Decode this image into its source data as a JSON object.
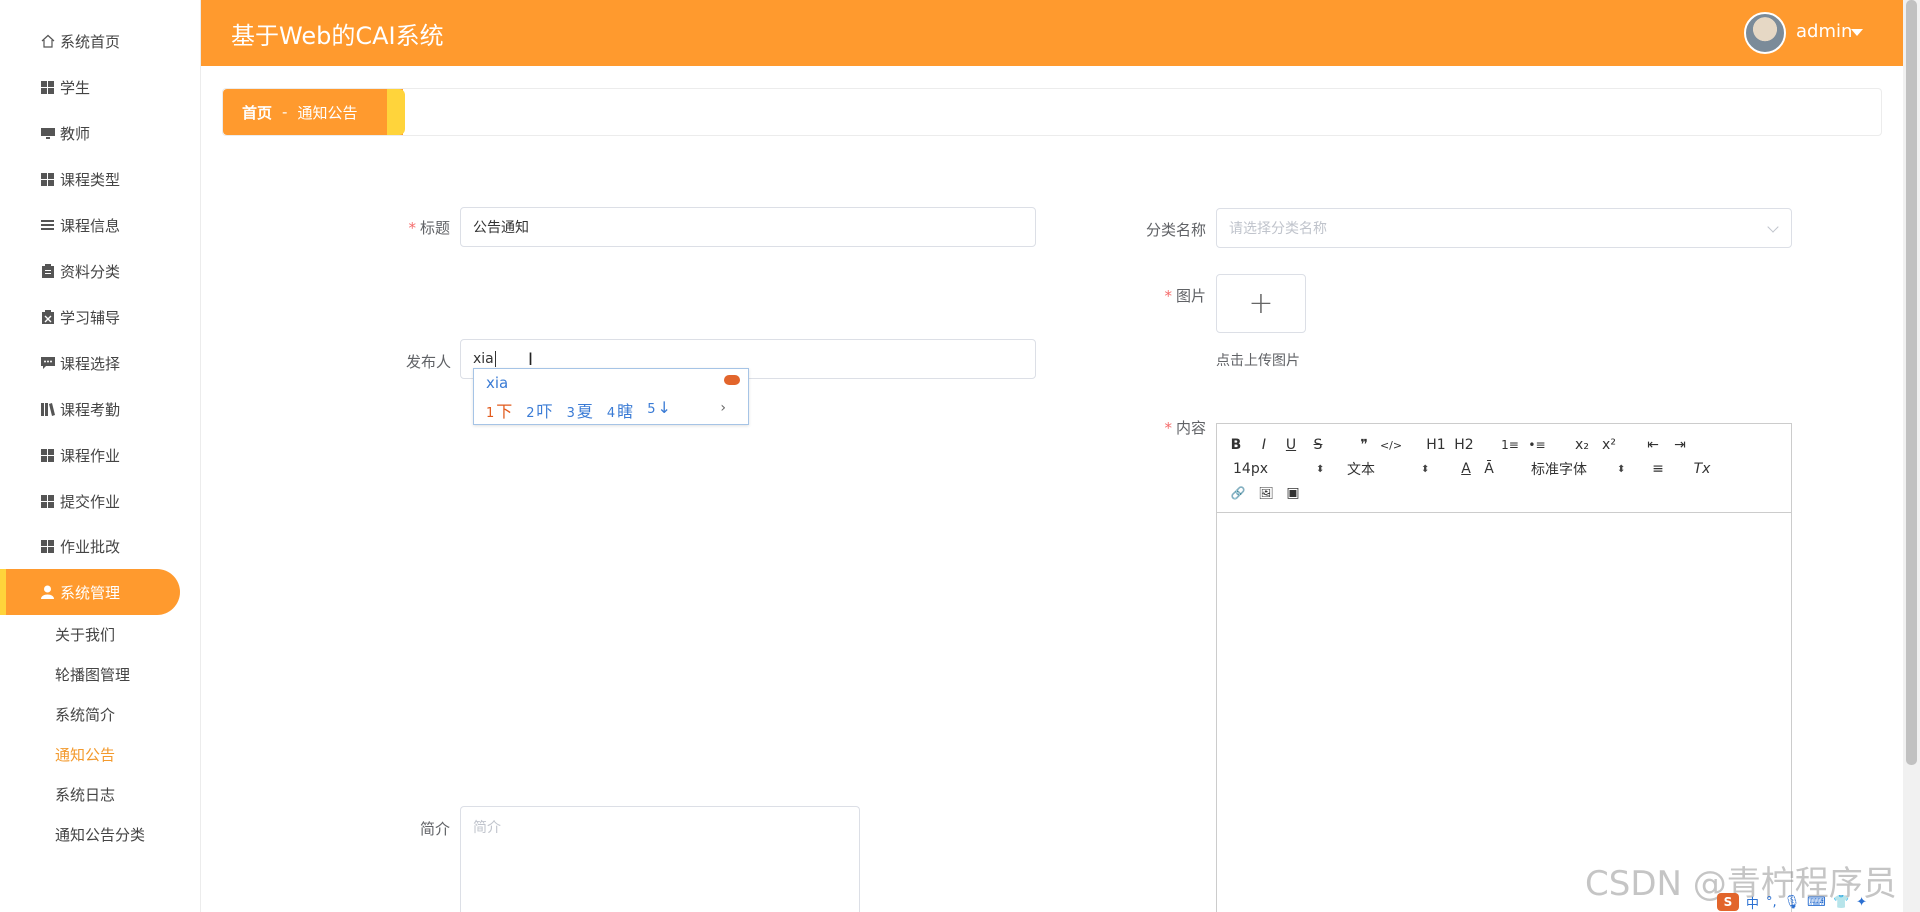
{
  "app": {
    "title": "基于Web的CAI系统"
  },
  "user": {
    "name": "admin"
  },
  "sidebar": {
    "items": [
      {
        "label": "系统首页",
        "icon": "home-icon"
      },
      {
        "label": "学生",
        "icon": "grid-icon"
      },
      {
        "label": "教师",
        "icon": "monitor-icon"
      },
      {
        "label": "课程类型",
        "icon": "grid-icon"
      },
      {
        "label": "课程信息",
        "icon": "menu-icon"
      },
      {
        "label": "资料分类",
        "icon": "clipboard-icon"
      },
      {
        "label": "学习辅导",
        "icon": "clipboard-x-icon"
      },
      {
        "label": "课程选择",
        "icon": "chat-icon"
      },
      {
        "label": "课程考勤",
        "icon": "book-icon"
      },
      {
        "label": "课程作业",
        "icon": "grid-icon"
      },
      {
        "label": "提交作业",
        "icon": "grid-icon"
      },
      {
        "label": "作业批改",
        "icon": "grid-icon"
      },
      {
        "label": "系统管理",
        "icon": "user-icon"
      }
    ],
    "submenu": [
      {
        "label": "关于我们"
      },
      {
        "label": "轮播图管理"
      },
      {
        "label": "系统简介"
      },
      {
        "label": "通知公告"
      },
      {
        "label": "系统日志"
      },
      {
        "label": "通知公告分类"
      }
    ]
  },
  "breadcrumb": {
    "home": "首页",
    "sep": "-",
    "current": "通知公告"
  },
  "form": {
    "title_label": "标题",
    "title_value": "公告通知",
    "publisher_label": "发布人",
    "publisher_value": "xia",
    "summary_label": "简介",
    "summary_placeholder": "简介",
    "category_label": "分类名称",
    "category_placeholder": "请选择分类名称",
    "image_label": "图片",
    "upload_symbol": "+",
    "upload_hint": "点击上传图片",
    "content_label": "内容"
  },
  "ime": {
    "composition": "xia",
    "candidates": [
      {
        "num": "1",
        "text": "下"
      },
      {
        "num": "2",
        "text": "吓"
      },
      {
        "num": "3",
        "text": "夏"
      },
      {
        "num": "4",
        "text": "瞎"
      },
      {
        "num": "5",
        "text": "↓"
      }
    ],
    "next": "›"
  },
  "editor": {
    "font_size": "14px",
    "block_type": "文本",
    "font_family": "标准字体",
    "buttons": [
      "B",
      "I",
      "U",
      "S",
      "❞",
      "</>",
      "H1",
      "H2",
      "1≡",
      "•≡",
      "x₂",
      "x²",
      "⇤",
      "⇥",
      "A",
      "Ā",
      "≡",
      "Tx",
      "🔗",
      "🖼",
      "▣"
    ]
  },
  "watermark": "CSDN @青柠程序员",
  "tray": {
    "logo": "S",
    "items": [
      "中",
      "°,",
      "🎙",
      "⌨",
      "👕",
      "✦"
    ]
  },
  "colors": {
    "accent": "#ff9a2e",
    "accent_edge": "#ffd43b",
    "required": "#f56c6c",
    "current_submenu": "#f39a2d"
  }
}
